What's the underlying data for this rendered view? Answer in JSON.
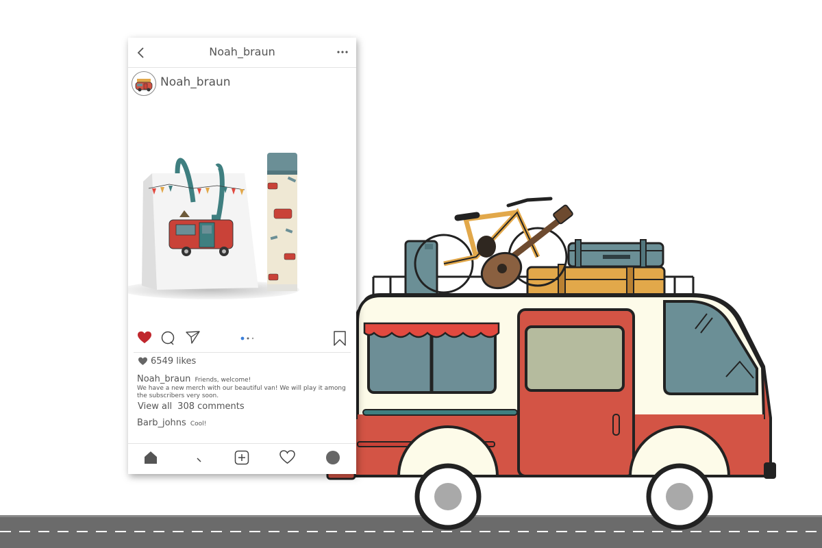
{
  "header": {
    "title": "Noah_braun"
  },
  "post": {
    "author": "Noah_braun",
    "likes": "6549 likes",
    "caption_user": "Noah_braun",
    "caption_title": "Friends, welcome!",
    "caption_body": "We have a new merch with our beautiful van! We will play it among the subscribers very soon.",
    "view_all_label": "View all",
    "comment_count": "308 comments",
    "carousel_pages": 3,
    "carousel_active": 1,
    "liked": true
  },
  "comment": {
    "user": "Barb_johns",
    "text": "Cool!"
  },
  "bottom_nav": {
    "items": [
      {
        "icon": "home-icon"
      },
      {
        "icon": "search-icon"
      },
      {
        "icon": "add-post-icon"
      },
      {
        "icon": "heart-icon"
      },
      {
        "icon": "profile-icon"
      }
    ]
  },
  "colors": {
    "like_red": "#c0272d",
    "van_red": "#d35445",
    "van_cream": "#fdfbe9",
    "van_teal": "#6b8f96",
    "window_blue": "#6d8e96",
    "door_glass": "#b5bb9e",
    "rack_mustard": "#e2a84a",
    "road_gray": "#6b6b6b",
    "awning_red": "#e2493f",
    "carousel_blue": "#3b7fd9"
  }
}
